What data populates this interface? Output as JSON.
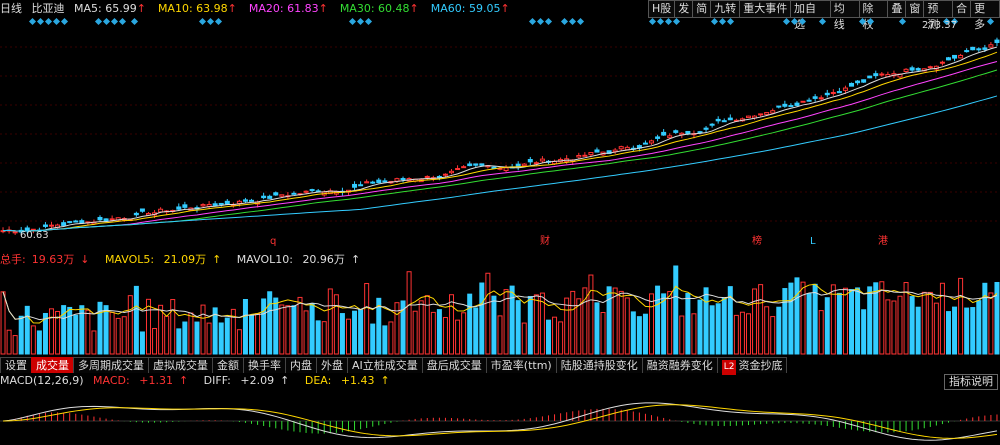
{
  "header": {
    "period": "日线",
    "stock_name": "比亚迪",
    "ma": [
      {
        "label": "MA5:",
        "value": "65.99",
        "arrow": "↑",
        "color": "#ddd"
      },
      {
        "label": "MA10:",
        "value": "63.98",
        "arrow": "↑",
        "color": "#ffd700"
      },
      {
        "label": "MA20:",
        "value": "61.83",
        "arrow": "↑",
        "color": "#ff44ff"
      },
      {
        "label": "MA30:",
        "value": "60.48",
        "arrow": "↑",
        "color": "#33dd33"
      },
      {
        "label": "MA60:",
        "value": "59.05",
        "arrow": "↑",
        "color": "#33ccff"
      }
    ]
  },
  "toolbar_left": [
    "H股",
    "发",
    "简",
    "九转",
    "重大事件",
    "▼"
  ],
  "toolbar_right": [
    "加自选",
    "均线",
    "除权",
    "叠",
    "窗",
    "预测",
    "合",
    "更多"
  ],
  "price_chart": {
    "high_label": "273.37",
    "low_label": "60.63",
    "events": [
      {
        "text": "q",
        "color": "#ff3333"
      },
      {
        "text": "财",
        "color": "#ff3333"
      },
      {
        "text": "榜",
        "color": "#ff3333"
      },
      {
        "text": "L",
        "color": "#33ccff"
      },
      {
        "text": "港",
        "color": "#ff3333"
      }
    ]
  },
  "volume": {
    "label": "总手:",
    "value": "19.63万",
    "value_arrow": "↓",
    "mavol5_label": "MAVOL5:",
    "mavol5": "21.09万",
    "mavol5_arrow": "↑",
    "mavol10_label": "MAVOL10:",
    "mavol10": "20.96万",
    "mavol10_arrow": "↑"
  },
  "tabs": [
    {
      "label": "设置",
      "active": false
    },
    {
      "label": "成交量",
      "active": true
    },
    {
      "label": "多周期成交量",
      "active": false
    },
    {
      "label": "虚拟成交量",
      "active": false
    },
    {
      "label": "金额",
      "active": false
    },
    {
      "label": "换手率",
      "active": false
    },
    {
      "label": "内盘",
      "active": false
    },
    {
      "label": "外盘",
      "active": false
    },
    {
      "label": "AI立桩成交量",
      "active": false
    },
    {
      "label": "盘后成交量",
      "active": false
    },
    {
      "label": "市盈率(ttm)",
      "active": false
    },
    {
      "label": "陆股通持股变化",
      "active": false
    },
    {
      "label": "融资融券变化",
      "active": false
    },
    {
      "label": "资金抄底",
      "active": false,
      "badge": "L2"
    }
  ],
  "macd": {
    "title": "MACD(12,26,9)",
    "macd_label": "MACD:",
    "macd": "+1.31",
    "macd_arrow": "↑",
    "diff_label": "DIFF:",
    "diff": "+2.09",
    "diff_arrow": "↑",
    "dea_label": "DEA:",
    "dea": "+1.43",
    "dea_arrow": "↑",
    "explain": "指标说明"
  },
  "colors": {
    "up": "#ff3333",
    "down": "#33ccff",
    "ma5": "#ddd",
    "ma10": "#ffd700",
    "ma20": "#ff44ff",
    "ma30": "#33dd33",
    "ma60": "#33ccff"
  }
}
